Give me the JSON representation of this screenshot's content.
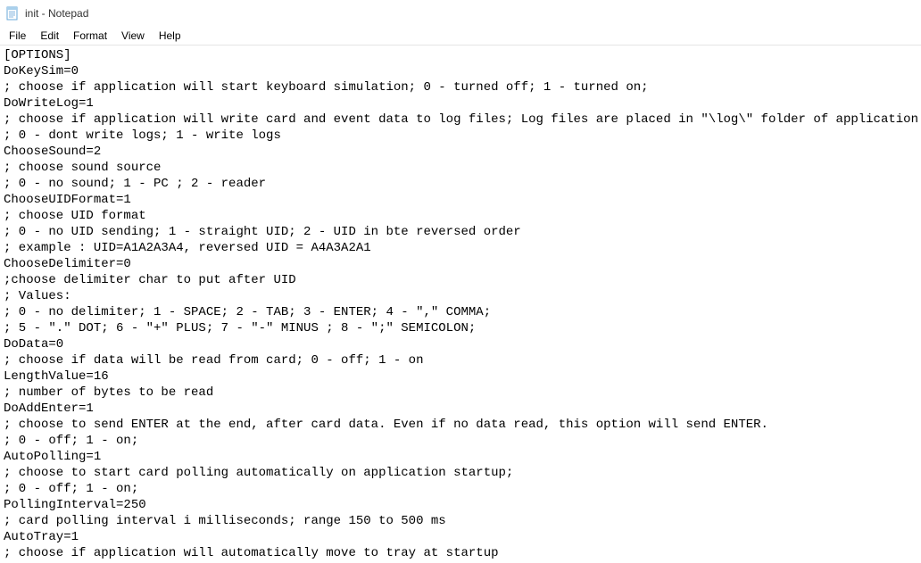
{
  "window": {
    "title": "init - Notepad"
  },
  "menu": {
    "file": "File",
    "edit": "Edit",
    "format": "Format",
    "view": "View",
    "help": "Help"
  },
  "document": {
    "lines": [
      "[OPTIONS]",
      "DoKeySim=0",
      "; choose if application will start keyboard simulation; 0 - turned off; 1 - turned on;",
      "DoWriteLog=1",
      "; choose if application will write card and event data to log files; Log files are placed in \"\\log\\\" folder of application root",
      "; 0 - dont write logs; 1 - write logs",
      "ChooseSound=2",
      "; choose sound source",
      "; 0 - no sound; 1 - PC ; 2 - reader",
      "ChooseUIDFormat=1",
      "; choose UID format",
      "; 0 - no UID sending; 1 - straight UID; 2 - UID in bte reversed order",
      "; example : UID=A1A2A3A4, reversed UID = A4A3A2A1",
      "ChooseDelimiter=0",
      ";choose delimiter char to put after UID",
      "; Values:",
      "; 0 - no delimiter; 1 - SPACE; 2 - TAB; 3 - ENTER; 4 - \",\" COMMA;",
      "; 5 - \".\" DOT; 6 - \"+\" PLUS; 7 - \"-\" MINUS ; 8 - \";\" SEMICOLON;",
      "DoData=0",
      "; choose if data will be read from card; 0 - off; 1 - on",
      "LengthValue=16",
      "; number of bytes to be read",
      "DoAddEnter=1",
      "; choose to send ENTER at the end, after card data. Even if no data read, this option will send ENTER.",
      "; 0 - off; 1 - on;",
      "AutoPolling=1",
      "; choose to start card polling automatically on application startup;",
      "; 0 - off; 1 - on;",
      "PollingInterval=250",
      "; card polling interval i milliseconds; range 150 to 500 ms",
      "AutoTray=1",
      "; choose if application will automatically move to tray at startup"
    ]
  }
}
